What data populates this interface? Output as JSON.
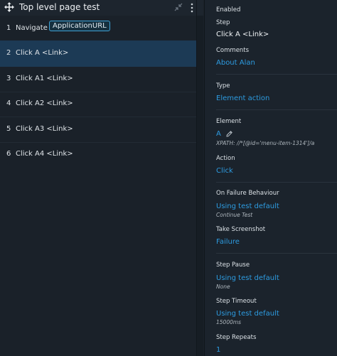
{
  "header": {
    "title": "Top level page test"
  },
  "steps": [
    {
      "num": "1",
      "label": "Navigate to",
      "tag": "ApplicationURL"
    },
    {
      "num": "2",
      "label": "Click A <Link>"
    },
    {
      "num": "3",
      "label": "Click A1 <Link>"
    },
    {
      "num": "4",
      "label": "Click A2 <Link>"
    },
    {
      "num": "5",
      "label": "Click A3 <Link>"
    },
    {
      "num": "6",
      "label": "Click A4 <Link>"
    }
  ],
  "selected_step": 2,
  "details": {
    "enabled_label": "Enabled",
    "step_label": "Step",
    "step_value": "Click A <Link>",
    "comments_label": "Comments",
    "comments_value": "About Alan",
    "type_label": "Type",
    "type_value": "Element action",
    "element_label": "Element",
    "element_value": "A",
    "element_xpath": "XPATH: //*[@id='menu-item-1314']/a",
    "action_label": "Action",
    "action_value": "Click",
    "on_failure_label": "On Failure Behaviour",
    "on_failure_value": "Using test default",
    "on_failure_sub": "Continue Test",
    "screenshot_label": "Take Screenshot",
    "screenshot_value": "Failure",
    "pause_label": "Step Pause",
    "pause_value": "Using test default",
    "pause_sub": "None",
    "timeout_label": "Step Timeout",
    "timeout_value": "Using test default",
    "timeout_sub": "15000ms",
    "repeats_label": "Step Repeats",
    "repeats_value": "1"
  },
  "colors": {
    "accent": "#2d9be0",
    "selected_row": "#1c3a55",
    "background": "#1a2129"
  }
}
